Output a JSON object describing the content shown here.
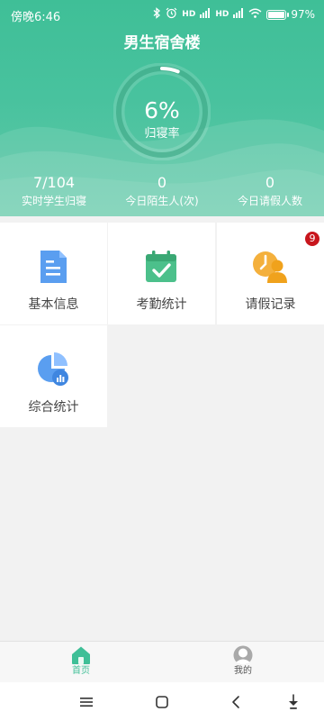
{
  "status_bar": {
    "time": "傍晚6:46",
    "signal_1": "HD",
    "signal_2": "HD",
    "battery_percent": "97%",
    "battery_level": 0.97
  },
  "header": {
    "title": "男生宿舍楼",
    "rate_value": "6%",
    "rate_label": "归寝率",
    "rate_fraction": 0.06
  },
  "stats": [
    {
      "value": "7/104",
      "label": "实时学生归寝"
    },
    {
      "value": "0",
      "label": "今日陌生人(次)"
    },
    {
      "value": "0",
      "label": "今日请假人数"
    }
  ],
  "tiles": [
    {
      "label": "基本信息",
      "icon": "document-icon"
    },
    {
      "label": "考勤统计",
      "icon": "calendar-check-icon"
    },
    {
      "label": "请假记录",
      "icon": "clock-user-icon",
      "badge": "9"
    },
    {
      "label": "综合统计",
      "icon": "pie-chart-icon"
    }
  ],
  "tabbar": {
    "home_label": "首页",
    "profile_label": "我的"
  },
  "colors": {
    "accent": "#3fbf97",
    "badge": "#c8161d"
  }
}
